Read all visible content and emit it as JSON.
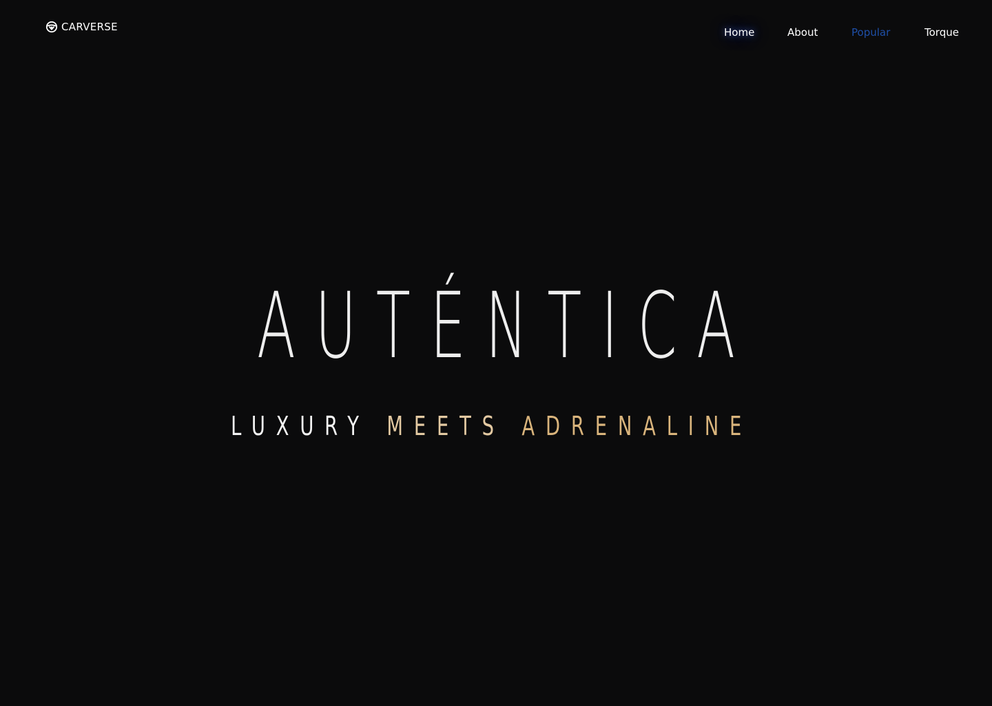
{
  "brand": {
    "name": "CARVERSE",
    "icon": "steering-wheel-icon"
  },
  "nav": {
    "items": [
      {
        "label": "Home",
        "state": "glow"
      },
      {
        "label": "About",
        "state": "default"
      },
      {
        "label": "Popular",
        "state": "active"
      },
      {
        "label": "Torque",
        "state": "default"
      }
    ]
  },
  "hero": {
    "title": "AUTÉNTICA",
    "tagline": {
      "word1": "LUXURY",
      "word2": "MEETS",
      "word3": "ADRENALINE"
    }
  },
  "colors": {
    "background": "#0b0b0c",
    "title": "#eeeeee",
    "nav_active": "#1e4fa8",
    "accent_gold": "#d9b47c"
  }
}
